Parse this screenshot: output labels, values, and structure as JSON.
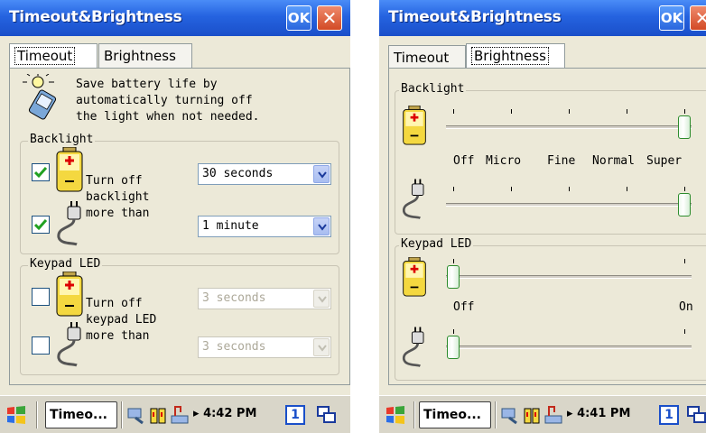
{
  "left_screen": {
    "title": "Timeout&Brightness",
    "ok_label": "OK",
    "close_label": "✕",
    "tabs": [
      {
        "label": "Timeout",
        "active": true
      },
      {
        "label": "Brightness",
        "active": false
      }
    ],
    "description": [
      "Save battery life by",
      "automatically turning off",
      "the light when not needed."
    ],
    "backlight": {
      "group_label": "Backlight",
      "text": [
        "Turn off",
        "backlight",
        "more than"
      ],
      "battery": {
        "checked": true,
        "value": "30 seconds"
      },
      "ac": {
        "checked": true,
        "value": "1 minute"
      }
    },
    "keypad": {
      "group_label": "Keypad LED",
      "text": [
        "Turn off",
        "keypad LED",
        "more than"
      ],
      "battery": {
        "checked": false,
        "value": "3 seconds",
        "disabled": true
      },
      "ac": {
        "checked": false,
        "value": "3 seconds",
        "disabled": true
      }
    },
    "taskbar": {
      "app": "Timeo...",
      "time": "4:42 PM",
      "input": "1"
    }
  },
  "right_screen": {
    "title": "Timeout&Brightness",
    "ok_label": "OK",
    "close_label": "✕",
    "tabs": [
      {
        "label": "Timeout",
        "active": false
      },
      {
        "label": "Brightness",
        "active": true
      }
    ],
    "backlight": {
      "group_label": "Backlight",
      "scale_labels": [
        "Off",
        "Micro",
        "Fine",
        "Normal",
        "Super"
      ],
      "battery_level": 4,
      "ac_level": 4,
      "max_level": 4
    },
    "keypad": {
      "group_label": "Keypad LED",
      "scale_labels": [
        "Off",
        "On"
      ],
      "battery_level": 0,
      "ac_level": 0,
      "max_level": 1
    },
    "taskbar": {
      "app": "Timeo...",
      "time": "4:41 PM",
      "input": "1"
    }
  },
  "colors": {
    "titlebar": "#2563e0",
    "checkbox_mark": "#21a121",
    "slider_thumb_border": "#2d8c2d",
    "close": "#d24a25"
  }
}
